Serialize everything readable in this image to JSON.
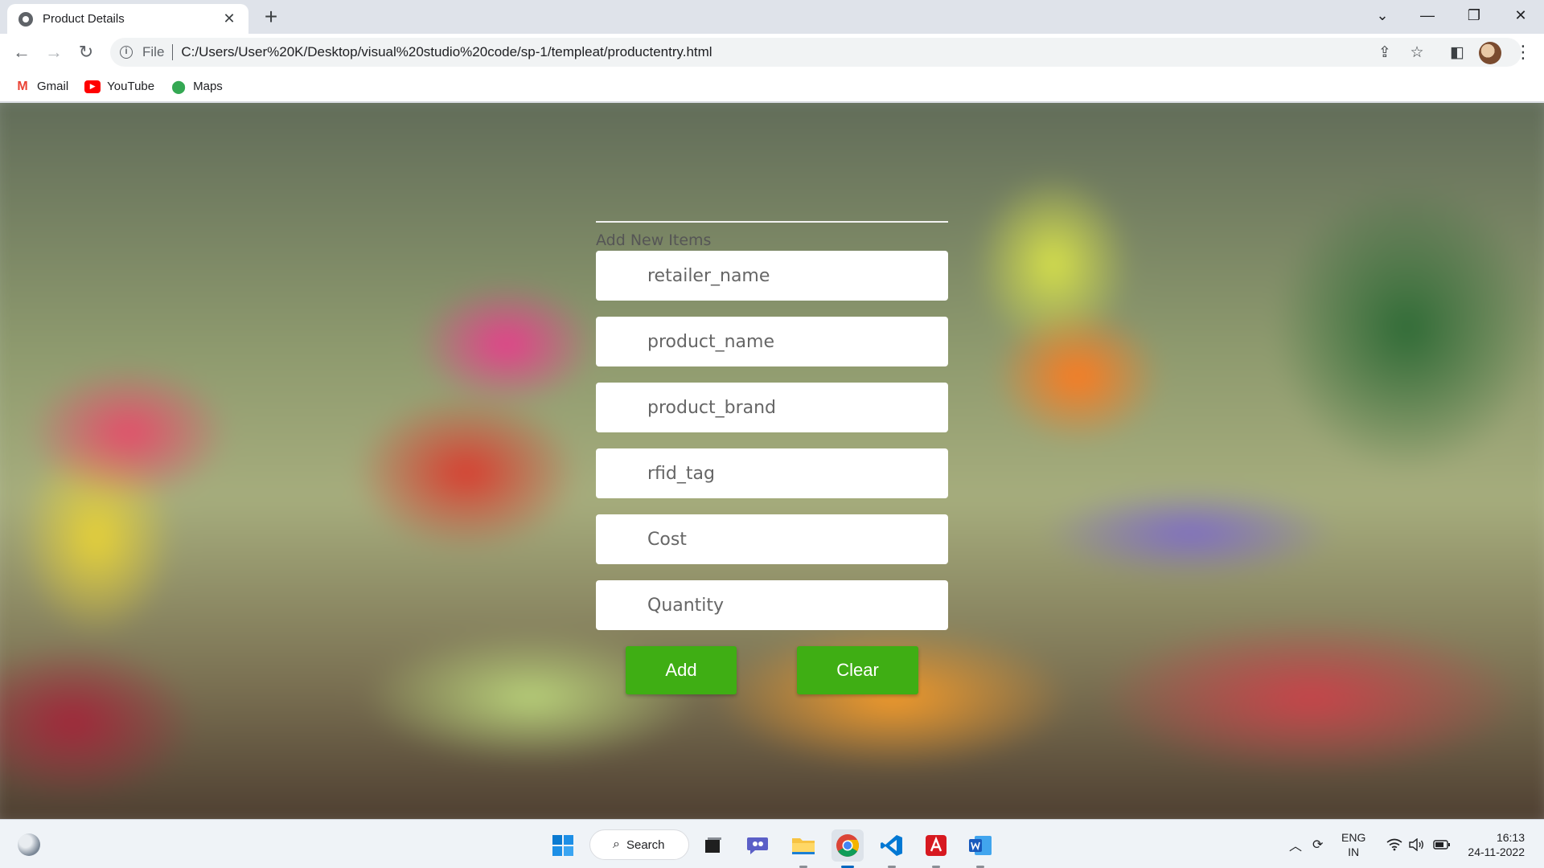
{
  "browser": {
    "tab_title": "Product Details",
    "new_tab": "+",
    "address_scheme": "File",
    "address_url": "C:/Users/User%20K/Desktop/visual%20studio%20code/sp-1/templeat/productentry.html",
    "bookmarks": [
      "Gmail",
      "YouTube",
      "Maps"
    ]
  },
  "form": {
    "heading": "Add New Items",
    "fields": {
      "retailer": "retailer_name",
      "product": "product_name",
      "brand": "product_brand",
      "rfid": "rfid_tag",
      "cost": "Cost",
      "quantity": "Quantity"
    },
    "add_label": "Add",
    "clear_label": "Clear",
    "button_color": "#3fae14"
  },
  "taskbar": {
    "search_label": "Search",
    "lang_line1": "ENG",
    "lang_line2": "IN",
    "time": "16:13",
    "date": "24-11-2022"
  }
}
